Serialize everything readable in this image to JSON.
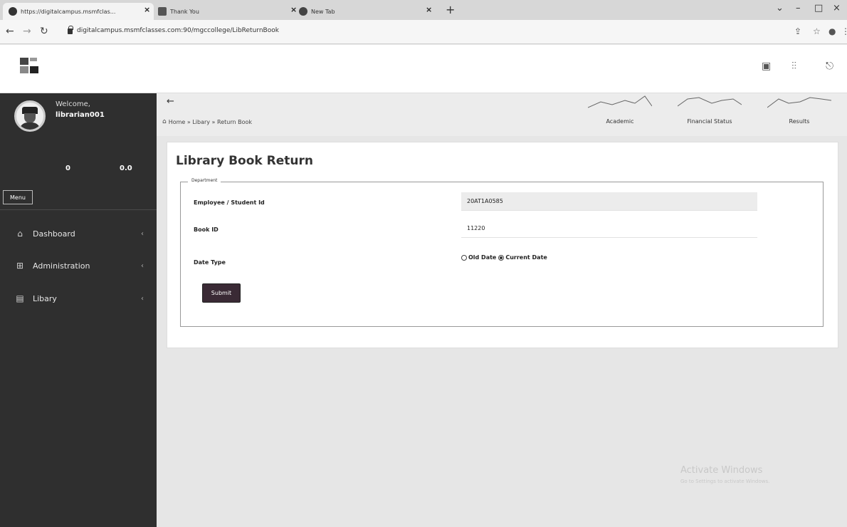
{
  "browser": {
    "tabs": [
      {
        "label": "https://digitalcampus.msmfclas...",
        "active": true
      },
      {
        "label": "Thank You",
        "active": false
      },
      {
        "label": "New Tab",
        "active": false
      }
    ],
    "url": "digitalcampus.msmfclasses.com:90/mgccollege/LibReturnBook"
  },
  "sidebar": {
    "welcome": "Welcome,",
    "username": "librarian001",
    "stats": [
      {
        "value": "0"
      },
      {
        "value": "0.0"
      }
    ],
    "menu_tab": "Menu",
    "items": [
      {
        "label": "Dashboard",
        "icon": "home-icon"
      },
      {
        "label": "Administration",
        "icon": "grid-icon"
      },
      {
        "label": "Libary",
        "icon": "book-icon"
      }
    ]
  },
  "breadcrumb": "Home » Libary » Return Book",
  "quick_links": [
    {
      "label": "Academic"
    },
    {
      "label": "Financial Status"
    },
    {
      "label": "Results"
    }
  ],
  "form": {
    "title": "Library Book Return",
    "legend": "Department",
    "employee_label": "Employee / Student Id",
    "employee_value": "20AT1A0585",
    "book_label": "Book ID",
    "book_value": "11220",
    "date_type_label": "Date Type",
    "date_options": [
      {
        "label": "Old Date",
        "checked": false
      },
      {
        "label": "Current Date",
        "checked": true
      }
    ],
    "submit_label": "Submit"
  },
  "watermark": {
    "line1": "Activate Windows",
    "line2": "Go to Settings to activate Windows."
  },
  "colors": {
    "sidebar_bg": "#2f2f2f",
    "submit_bg": "#3a2a35",
    "page_bg": "#e6e6e6"
  }
}
